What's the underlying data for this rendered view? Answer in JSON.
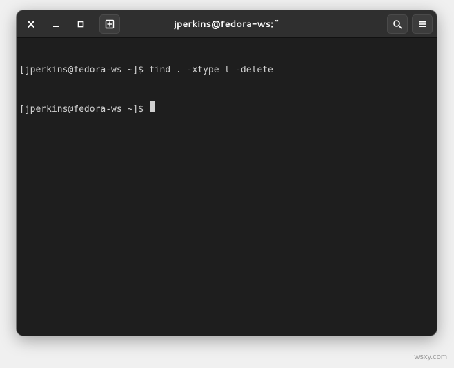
{
  "titlebar": {
    "title": "jperkins@fedora-ws:~",
    "close_icon": "close-icon",
    "minimize_icon": "minimize-icon",
    "maximize_icon": "maximize-icon",
    "newtab_icon": "new-tab-icon",
    "search_icon": "search-icon",
    "menu_icon": "hamburger-menu-icon"
  },
  "terminal": {
    "lines": [
      {
        "prompt": "[jperkins@fedora-ws ~]$ ",
        "command": "find . -xtype l -delete"
      },
      {
        "prompt": "[jperkins@fedora-ws ~]$ ",
        "command": ""
      }
    ]
  },
  "watermark": "wsxy.com"
}
